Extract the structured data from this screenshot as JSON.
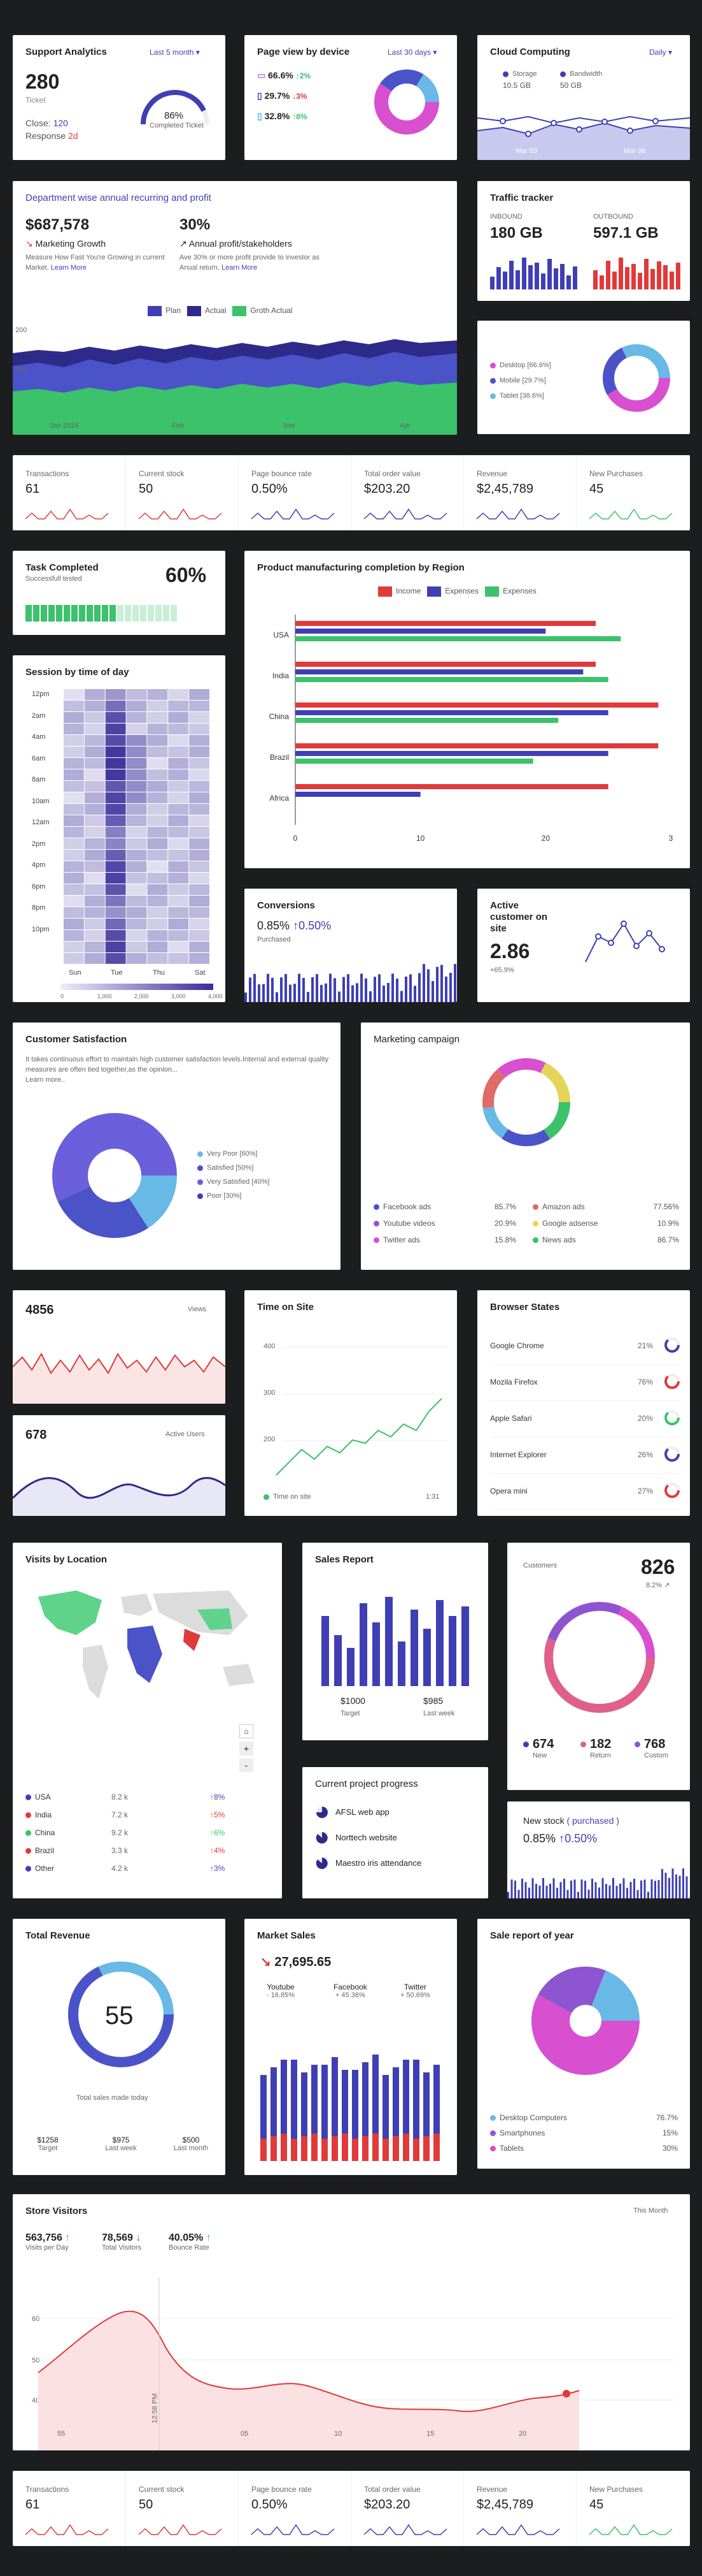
{
  "support": {
    "title": "Support Analytics",
    "period": "Last 5 month",
    "value": "280",
    "value_label": "Ticket",
    "close_label": "Close:",
    "close_val": "120",
    "resp_label": "Response",
    "resp_val": "2d",
    "gauge_pct": "86%",
    "gauge_label": "Completed Ticket",
    "gauge_frac": 0.86
  },
  "device": {
    "title": "Page view by device",
    "period": "Last 30 days",
    "rows": [
      {
        "pct": "66.6%",
        "chg": "2%",
        "dir": "up"
      },
      {
        "pct": "29.7%",
        "chg": "3%",
        "dir": "down"
      },
      {
        "pct": "32.8%",
        "chg": "8%",
        "dir": "up"
      }
    ]
  },
  "cloud": {
    "title": "Cloud Computing",
    "period": "Daily",
    "l1": "Storage",
    "v1": "10.5 GB",
    "l2": "Bandwidth",
    "v2": "50 GB",
    "x1": "Mar 03",
    "x2": "Mar 06"
  },
  "dept": {
    "title": "Department wise annual recurring and profit",
    "v1": "$687,578",
    "l1": "Marketing Growth",
    "d1": "Measure How Fast You're Growing in current Market.",
    "lm1": "Learn More",
    "v2": "30%",
    "l2": "Annual profit/stakeholders",
    "d2": "Ave 30% or more profit provide to investor as Anual return.",
    "lm2": "Learn More",
    "legend": [
      "Plan",
      "Actual",
      "Groth Actual"
    ],
    "y1": "200",
    "y2": "150",
    "x": [
      "Jan 2018",
      "Feb",
      "Mar",
      "Apr"
    ]
  },
  "traffic": {
    "title": "Traffic tracker",
    "in_label": "INBOUND",
    "in_val": "180 GB",
    "out_label": "OUTBOUND",
    "out_val": "597.1 GB"
  },
  "devpie": {
    "items": [
      "Desktop [66.6%]",
      "Mobile [29.7%]",
      "Tablet [38.6%]"
    ]
  },
  "stats": [
    {
      "label": "Transactions",
      "value": "61"
    },
    {
      "label": "Current stock",
      "value": "50"
    },
    {
      "label": "Page bounce rate",
      "value": "0.50%"
    },
    {
      "label": "Total order value",
      "value": "$203.20"
    },
    {
      "label": "Revenue",
      "value": "$2,45,789"
    },
    {
      "label": "New Purchases",
      "value": "45"
    }
  ],
  "task": {
    "title": "Task Completed",
    "sub": "Successfull tested",
    "pct": "60%",
    "frac": 0.6
  },
  "session": {
    "title": "Session by time of day",
    "hours": [
      "12pm",
      "2am",
      "4am",
      "6am",
      "8am",
      "10am",
      "12am",
      "2pm",
      "4pm",
      "6pm",
      "8pm",
      "10pm"
    ],
    "days": [
      "Sun",
      "Tue",
      "Thu",
      "Sat"
    ],
    "scale": [
      "0",
      "1,000",
      "2,000",
      "3,000",
      "4,000"
    ]
  },
  "chart_data": [
    {
      "type": "bar",
      "title": "Product manufacturing completion by Region",
      "categories": [
        "USA",
        "India",
        "China",
        "Brazil",
        "Africa"
      ],
      "series": [
        {
          "name": "Income",
          "values": [
            2.4,
            2.4,
            2.9,
            2.9,
            2.5
          ]
        },
        {
          "name": "Expenses",
          "values": [
            2.0,
            2.3,
            2.5,
            2.5,
            1.0
          ]
        },
        {
          "name": "Expenses",
          "values": [
            2.6,
            2.5,
            2.1,
            1.9,
            null
          ]
        }
      ],
      "xlim": [
        0,
        3
      ],
      "xticks": [
        "0",
        "10",
        "20",
        "3"
      ]
    }
  ],
  "conv": {
    "title": "Conversions",
    "value": "0.85%",
    "chg": "0.50%",
    "sub": "Purchased"
  },
  "active": {
    "title": "Active customer on site",
    "value": "2.86",
    "chg": "+65.9%"
  },
  "csat": {
    "title": "Customer Satisfaction",
    "desc": "It takes continuous effort to maintain high customer satisfaction levels.Internal and external quality measures are often tied together,as the opinion...",
    "more": "Learn more..",
    "items": [
      "Very Poor [60%]",
      "Satisfied [50%]",
      "Very Satisfied [40%]",
      "Poor [30%]"
    ]
  },
  "camp": {
    "title": "Marketing campaign",
    "rows": [
      [
        "Facebook ads",
        "85.7%",
        "Amazon ads",
        "77.56%"
      ],
      [
        "Youtube videos",
        "20.9%",
        "Google adsense",
        "10.9%"
      ],
      [
        "Twitter ads",
        "15.8%",
        "News ads",
        "86.7%"
      ]
    ]
  },
  "views": {
    "value": "4856",
    "label": "Views"
  },
  "users": {
    "value": "678",
    "label": "Active Users"
  },
  "tos": {
    "title": "Time on Site",
    "y": [
      "400",
      "300",
      "200"
    ],
    "legend": "Time on site",
    "time": "1:31"
  },
  "browser": {
    "title": "Browser States",
    "rows": [
      {
        "name": "Google Chrome",
        "pct": "21%"
      },
      {
        "name": "Mozila Firefox",
        "pct": "76%"
      },
      {
        "name": "Apple Safari",
        "pct": "20%"
      },
      {
        "name": "Internet Explorer",
        "pct": "26%"
      },
      {
        "name": "Opera mini",
        "pct": "27%"
      }
    ]
  },
  "visits": {
    "title": "Visits by Location",
    "rows": [
      {
        "c": "USA",
        "v": "8.2 k",
        "p": "8%"
      },
      {
        "c": "India",
        "v": "7.2 k",
        "p": "5%"
      },
      {
        "c": "China",
        "v": "9.2 k",
        "p": "6%"
      },
      {
        "c": "Brazil",
        "v": "3.3 k",
        "p": "4%"
      },
      {
        "c": "Other",
        "v": "4.2 k",
        "p": "3%"
      }
    ]
  },
  "sales": {
    "title": "Sales Report",
    "v1": "$1000",
    "l1": "Target",
    "v2": "$985",
    "l2": "Last week"
  },
  "cust": {
    "label": "Customers",
    "value": "826",
    "chg": "8.2%",
    "items": [
      {
        "v": "674",
        "l": "New"
      },
      {
        "v": "182",
        "l": "Return"
      },
      {
        "v": "768",
        "l": "Custom"
      }
    ]
  },
  "proj": {
    "title": "Current project progress",
    "items": [
      "AFSL web app",
      "Norttech website",
      "Maestro iris attendance"
    ]
  },
  "stock": {
    "title": "New stock",
    "title2": "( purchased )",
    "value": "0.85%",
    "chg": "0.50%"
  },
  "rev": {
    "title": "Total Revenue",
    "value": "55",
    "sub": "Total sales made today",
    "c": [
      {
        "v": "$1258",
        "l": "Target"
      },
      {
        "v": "$975",
        "l": "Last week"
      },
      {
        "v": "$500",
        "l": "Last month"
      }
    ]
  },
  "msales": {
    "title": "Market Sales",
    "value": "27,695.65",
    "c": [
      {
        "n": "Youtube",
        "v": "- 16.85%"
      },
      {
        "n": "Facebook",
        "v": "+ 45.36%"
      },
      {
        "n": "Twitter",
        "v": "+ 50.69%"
      }
    ]
  },
  "year": {
    "title": "Sale report of year",
    "items": [
      {
        "n": "Desktop Computers",
        "v": "76.7%"
      },
      {
        "n": "Smartphones",
        "v": "15%"
      },
      {
        "n": "Tablets",
        "v": "30%"
      }
    ]
  },
  "store": {
    "title": "Store Visitors",
    "period": "This Month",
    "s": [
      {
        "v": "563,756",
        "l": "Visits per Day"
      },
      {
        "v": "78,569",
        "l": "Total Visitors"
      },
      {
        "v": "40.05%",
        "l": "Bounce Rate"
      }
    ],
    "y": [
      "60",
      "50",
      "40"
    ],
    "x": [
      "55",
      "05",
      "10",
      "15",
      "20"
    ],
    "time": "12:58 PM"
  }
}
